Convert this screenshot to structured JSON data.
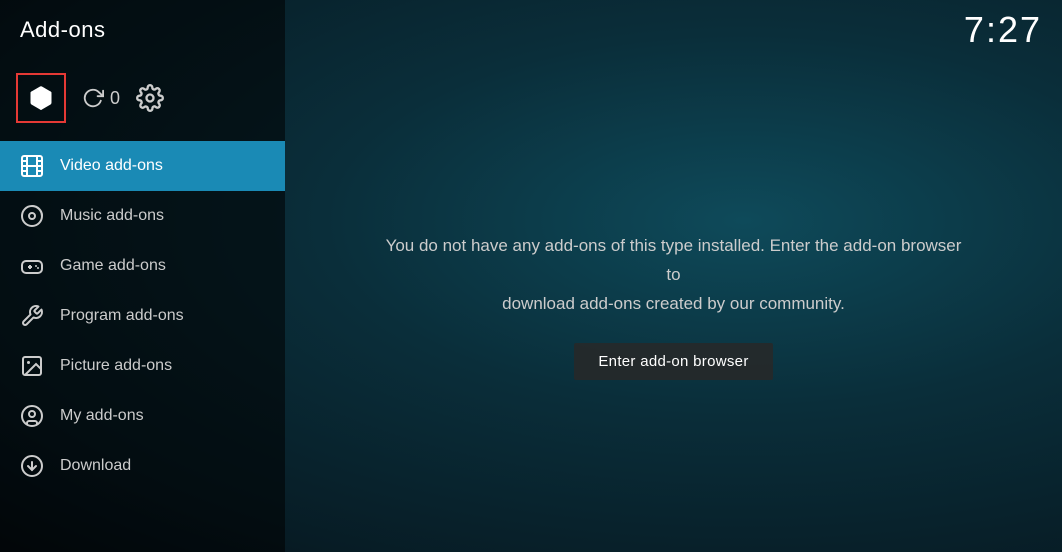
{
  "header": {
    "title": "Add-ons",
    "time": "7:27"
  },
  "sidebar": {
    "update_count": "0",
    "nav_items": [
      {
        "id": "video",
        "label": "Video add-ons",
        "active": true,
        "icon": "film"
      },
      {
        "id": "music",
        "label": "Music add-ons",
        "active": false,
        "icon": "music"
      },
      {
        "id": "game",
        "label": "Game add-ons",
        "active": false,
        "icon": "game"
      },
      {
        "id": "program",
        "label": "Program add-ons",
        "active": false,
        "icon": "program"
      },
      {
        "id": "picture",
        "label": "Picture add-ons",
        "active": false,
        "icon": "picture"
      },
      {
        "id": "myaddon",
        "label": "My add-ons",
        "active": false,
        "icon": "myaddon"
      },
      {
        "id": "download",
        "label": "Download",
        "active": false,
        "icon": "download"
      }
    ]
  },
  "main": {
    "empty_message_line1": "You do not have any add-ons of this type installed. Enter the add-on browser to",
    "empty_message_line2": "download add-ons created by our community.",
    "browser_button_label": "Enter add-on browser"
  }
}
